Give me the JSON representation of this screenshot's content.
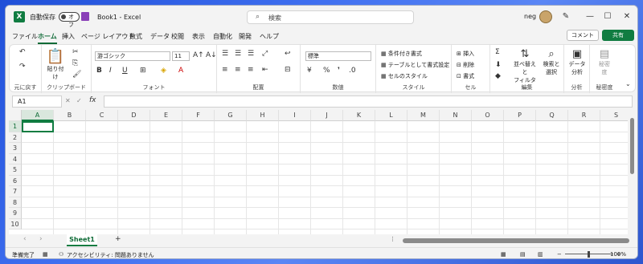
{
  "titlebar": {
    "autosave_label": "自動保存",
    "toggle_state": "オフ",
    "filename": "Book1 - Excel",
    "search_placeholder": "検索",
    "user": "neg",
    "min": "—",
    "max": "☐",
    "close": "✕"
  },
  "tabs": [
    "ファイル",
    "ホーム",
    "挿入",
    "ページ レイアウト",
    "数式",
    "データ",
    "校閲",
    "表示",
    "自動化",
    "開発",
    "ヘルプ"
  ],
  "active_tab": "ホーム",
  "comment_label": "コメント",
  "share_label": "共有",
  "ribbon": {
    "undo_group": "元に戻す",
    "clipboard": {
      "label": "クリップボード",
      "paste": "貼り付け"
    },
    "font": {
      "label": "フォント",
      "name": "游ゴシック",
      "size": "11"
    },
    "alignment": {
      "label": "配置"
    },
    "number": {
      "label": "数値",
      "format": "標準"
    },
    "styles": {
      "label": "スタイル",
      "cond": "条件付き書式",
      "table": "テーブルとして書式設定",
      "cell": "セルのスタイル"
    },
    "cells": {
      "label": "セル",
      "insert": "挿入",
      "delete": "削除",
      "format": "書式"
    },
    "edit": {
      "label": "編集",
      "sort": "並べ替えと",
      "sort2": "フィルター",
      "find": "検索と",
      "find2": "選択"
    },
    "analysis": {
      "label": "分析",
      "btn": "データ",
      "btn2": "分析"
    },
    "sensitivity": {
      "label": "秘密度",
      "btn": "秘密",
      "btn2": "度"
    }
  },
  "formula_bar": {
    "cell_ref": "A1",
    "fx": "fx"
  },
  "columns": [
    "A",
    "B",
    "C",
    "D",
    "E",
    "F",
    "G",
    "H",
    "I",
    "J",
    "K",
    "L",
    "M",
    "N",
    "O",
    "P",
    "Q",
    "R",
    "S"
  ],
  "rows": [
    "1",
    "2",
    "3",
    "4",
    "5",
    "6",
    "7",
    "8",
    "9",
    "10"
  ],
  "sheet": {
    "name": "Sheet1",
    "add": "+"
  },
  "status": {
    "ready": "準備完了",
    "accessibility": "アクセシビリティ: 問題ありません",
    "zoom": "100%"
  }
}
